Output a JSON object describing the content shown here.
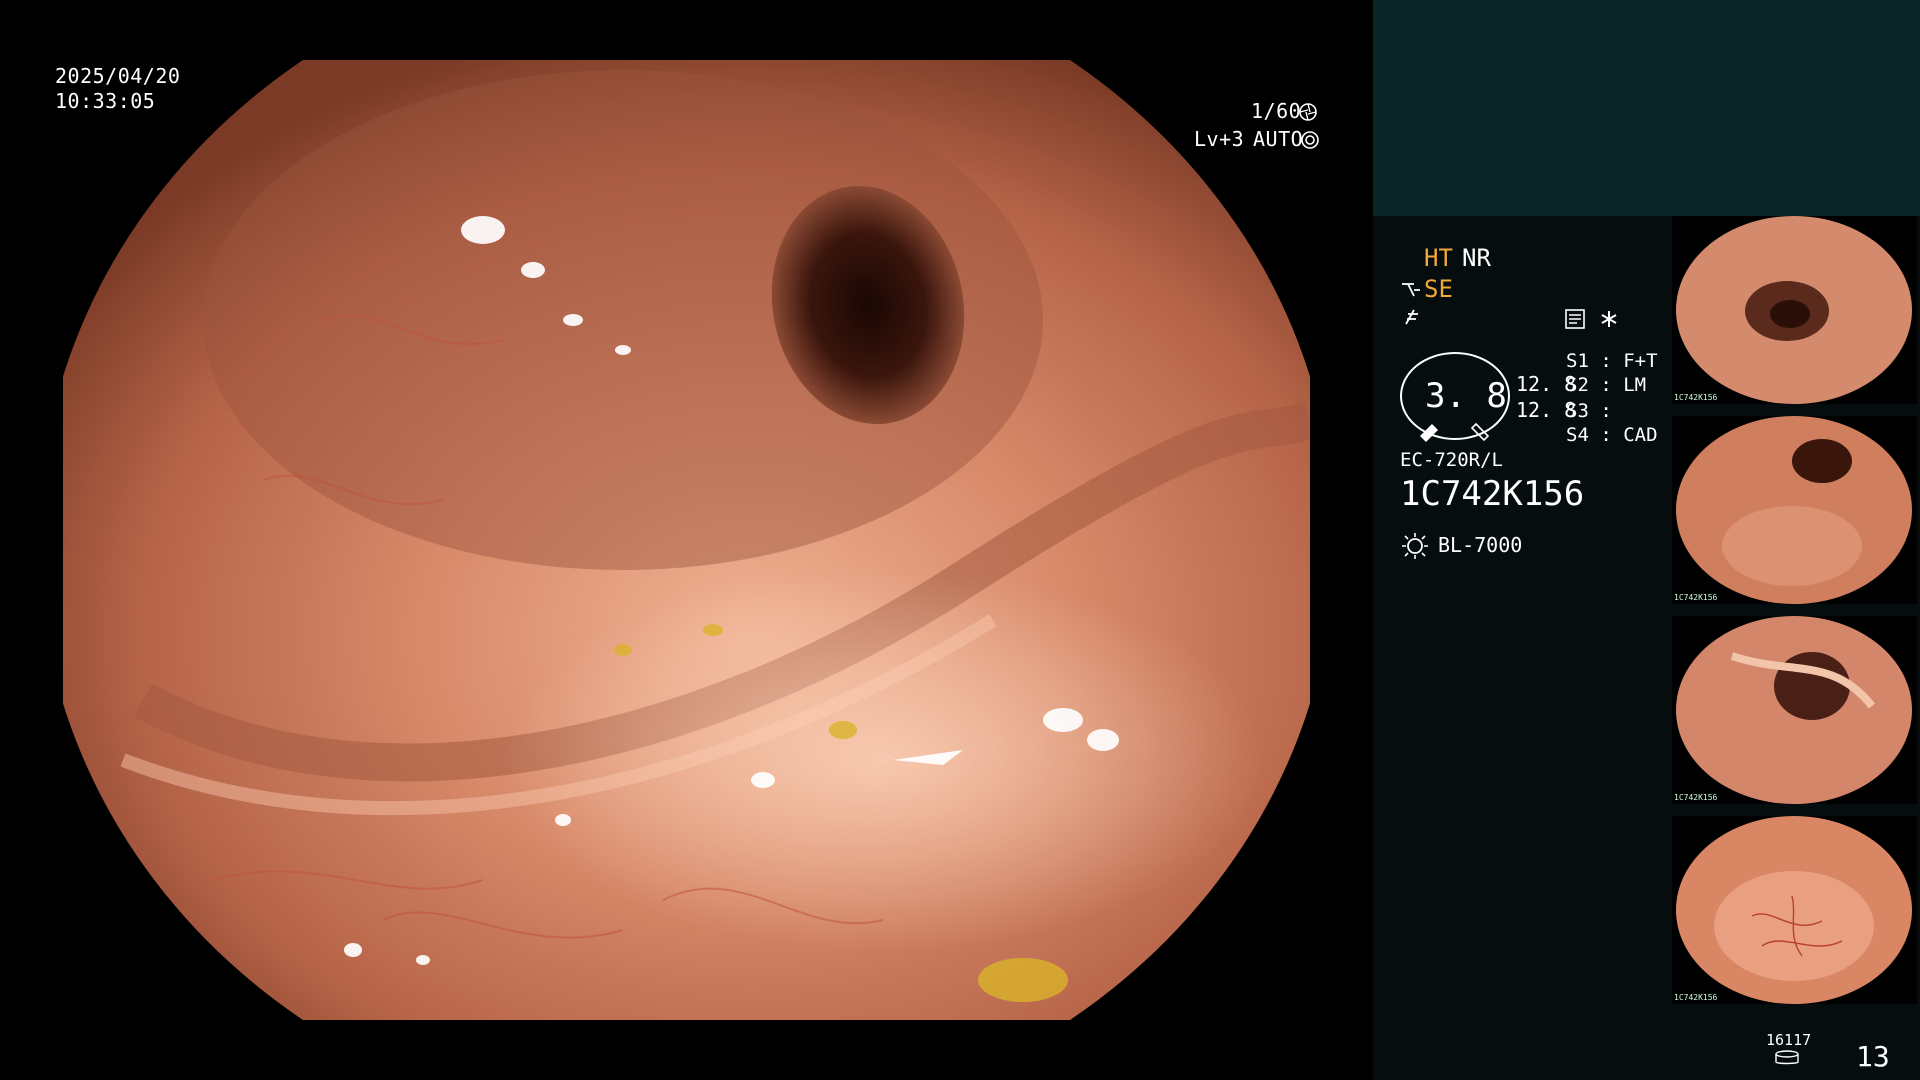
{
  "osd": {
    "date": "2025/04/20",
    "time": "10:33:05",
    "shutter": "1/60",
    "level": "Lv+3",
    "exposure_mode": "AUTO"
  },
  "panel": {
    "ht": "HT",
    "nr": "NR",
    "se": "SE",
    "zoom_value": "3. 8",
    "scale_upper": "12. 8",
    "scale_lower": "12. 8",
    "s1": "S1 : F+T",
    "s2": "S2 : LM",
    "s3": "S3 :",
    "s4": "S4 : CAD",
    "scope_model": "EC-720R/L",
    "scope_serial": "1C742K156",
    "light_source": "BL-7000",
    "storage_count": "16117",
    "image_count": "13"
  },
  "thumbnails": [
    {
      "caption": "1C742K156"
    },
    {
      "caption": "1C742K156"
    },
    {
      "caption": "1C742K156"
    },
    {
      "caption": "1C742K156"
    }
  ],
  "icons": [
    "shutter-icon",
    "auto-exposure-icon",
    "se-scope-icon",
    "freeze-icon",
    "memo-icon",
    "asterisk-icon",
    "light-bulb-icon",
    "storage-icon"
  ],
  "colors": {
    "panel_top": "#0b2526",
    "panel_bottom": "#050d0e",
    "highlight": "#f2a93a"
  }
}
